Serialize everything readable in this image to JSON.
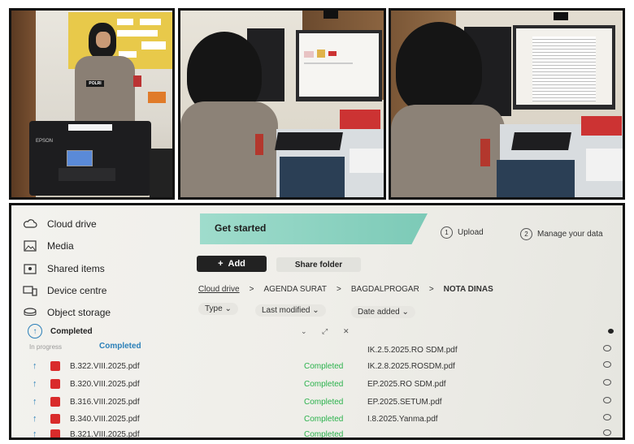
{
  "photo_left": {
    "printer_brand": "EPSON",
    "vest_label": "POLRI"
  },
  "screen": {
    "sidebar": {
      "items": [
        {
          "label": "Cloud drive",
          "icon": "cloud-icon"
        },
        {
          "label": "Media",
          "icon": "image-icon"
        },
        {
          "label": "Shared items",
          "icon": "shared-folder-icon"
        },
        {
          "label": "Device centre",
          "icon": "device-icon"
        },
        {
          "label": "Object storage",
          "icon": "storage-icon"
        }
      ]
    },
    "completed_label": "Completed",
    "tabs": {
      "in_progress": "In progress",
      "completed": "Completed"
    },
    "get_started": "Get started",
    "steps": [
      {
        "num": "1",
        "label": "Upload"
      },
      {
        "num": "2",
        "label": "Manage your data"
      }
    ],
    "add_button": "Add",
    "share_button": "Share folder",
    "breadcrumb": [
      "Cloud drive",
      "AGENDA SURAT",
      "BAGDALPROGAR",
      "NOTA DINAS"
    ],
    "breadcrumb_sep": ">",
    "filters": [
      "Type",
      "Last modified",
      "Date added"
    ],
    "rows": [
      {
        "file": "",
        "status": "",
        "remote": "IK.2.5.2025.RO SDM.pdf"
      },
      {
        "file": "B.322.VIII.2025.pdf",
        "status": "Completed",
        "remote": "IK.2.8.2025.ROSDM.pdf"
      },
      {
        "file": "B.320.VIII.2025.pdf",
        "status": "Completed",
        "remote": "EP.2025.RO SDM.pdf"
      },
      {
        "file": "B.316.VIII.2025.pdf",
        "status": "Completed",
        "remote": "EP.2025.SETUM.pdf"
      },
      {
        "file": "B.340.VIII.2025.pdf",
        "status": "Completed",
        "remote": "I.8.2025.Yanma.pdf"
      },
      {
        "file": "B.321.VIII.2025.pdf",
        "status": "Completed",
        "remote": ""
      }
    ],
    "colors": {
      "accent_teal": "#8fd6c6",
      "status_green": "#2bb24c",
      "pdf_red": "#d92b2b",
      "upload_blue": "#2a7fb8"
    }
  }
}
